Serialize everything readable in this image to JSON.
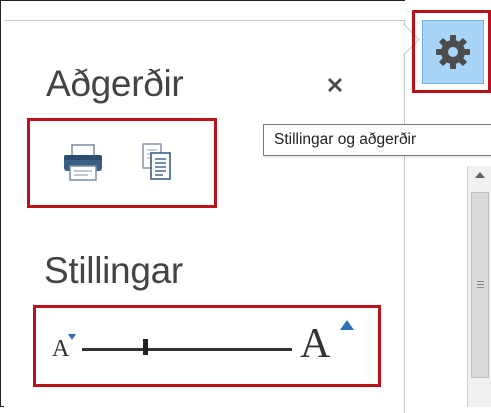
{
  "panel": {
    "actions_heading": "Aðgerðir",
    "settings_heading": "Stillingar"
  },
  "tooltip": {
    "text": "Stillingar og aðgerðir"
  },
  "text_size": {
    "small_glyph": "A",
    "large_glyph": "A",
    "level": 0.3
  },
  "icons": {
    "close": "close-icon",
    "print": "print-icon",
    "copy": "copy-icon",
    "gear": "gear-icon"
  },
  "colors": {
    "highlight": "#b8121a",
    "gear_button_bg": "#a8d4f7",
    "accent_triangle": "#2f6fb5",
    "heading_text": "#444444"
  }
}
